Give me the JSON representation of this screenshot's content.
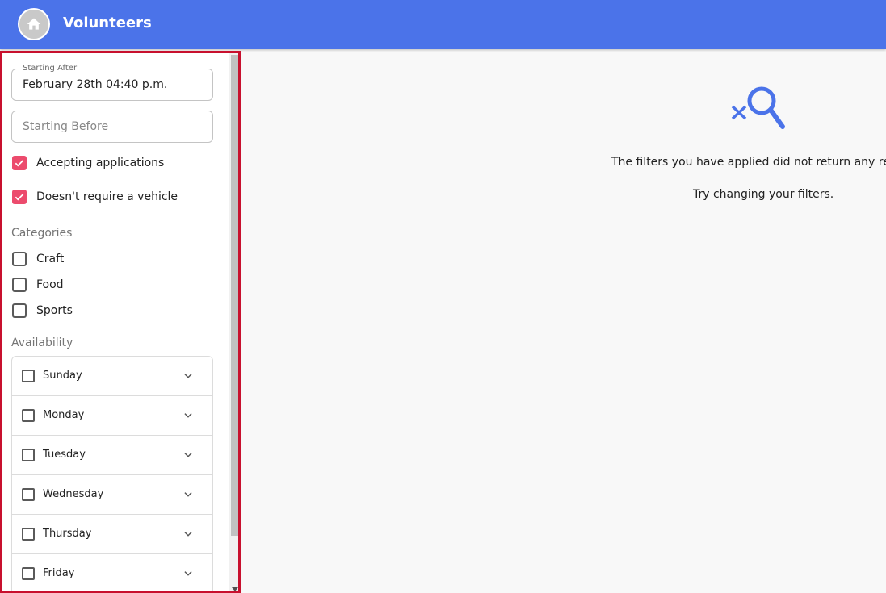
{
  "header": {
    "title": "Volunteers",
    "home_icon": "home-icon",
    "color": "#4b73e9"
  },
  "filters": {
    "starting_after": {
      "label": "Starting After",
      "value": "February 28th 04:40 p.m."
    },
    "starting_before": {
      "placeholder": "Starting Before"
    },
    "accepting_applications": {
      "label": "Accepting applications",
      "checked": true
    },
    "no_vehicle": {
      "label": "Doesn't require a vehicle",
      "checked": true
    },
    "checkbox_color": "#ec4b6d",
    "categories": {
      "title": "Categories",
      "items": [
        {
          "label": "Craft",
          "checked": false
        },
        {
          "label": "Food",
          "checked": false
        },
        {
          "label": "Sports",
          "checked": false
        }
      ]
    },
    "availability": {
      "title": "Availability",
      "days": [
        {
          "label": "Sunday",
          "checked": false
        },
        {
          "label": "Monday",
          "checked": false
        },
        {
          "label": "Tuesday",
          "checked": false
        },
        {
          "label": "Wednesday",
          "checked": false
        },
        {
          "label": "Thursday",
          "checked": false
        },
        {
          "label": "Friday",
          "checked": false
        }
      ]
    }
  },
  "results": {
    "empty_icon": "search-off-icon",
    "message": "The filters you have applied did not return any results.",
    "hint": "Try changing your filters."
  }
}
